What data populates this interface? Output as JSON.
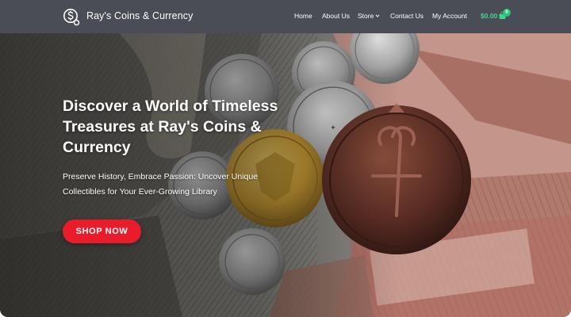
{
  "header": {
    "brand": "Ray's Coins & Currency",
    "logo_icon": "coin-dollar-icon",
    "nav": [
      {
        "label": "Home"
      },
      {
        "label": "About Us"
      },
      {
        "label": "Store",
        "has_dropdown": true
      },
      {
        "label": "Contact Us"
      },
      {
        "label": "My Account"
      }
    ],
    "cart": {
      "amount": "$0.00",
      "count": "0",
      "icon": "shopping-basket-icon"
    }
  },
  "hero": {
    "title": "Discover a World of Timeless Treasures at Ray's Coins & Currency",
    "subtitle": "Preserve History, Embrace Passion: Uncover Unique Collectibles for Your Ever-Growing Library",
    "cta_label": "SHOP NOW"
  },
  "colors": {
    "header_bg": "#4b4d56",
    "accent_green": "#3fd68a",
    "cta_red": "#ea1c2c"
  }
}
